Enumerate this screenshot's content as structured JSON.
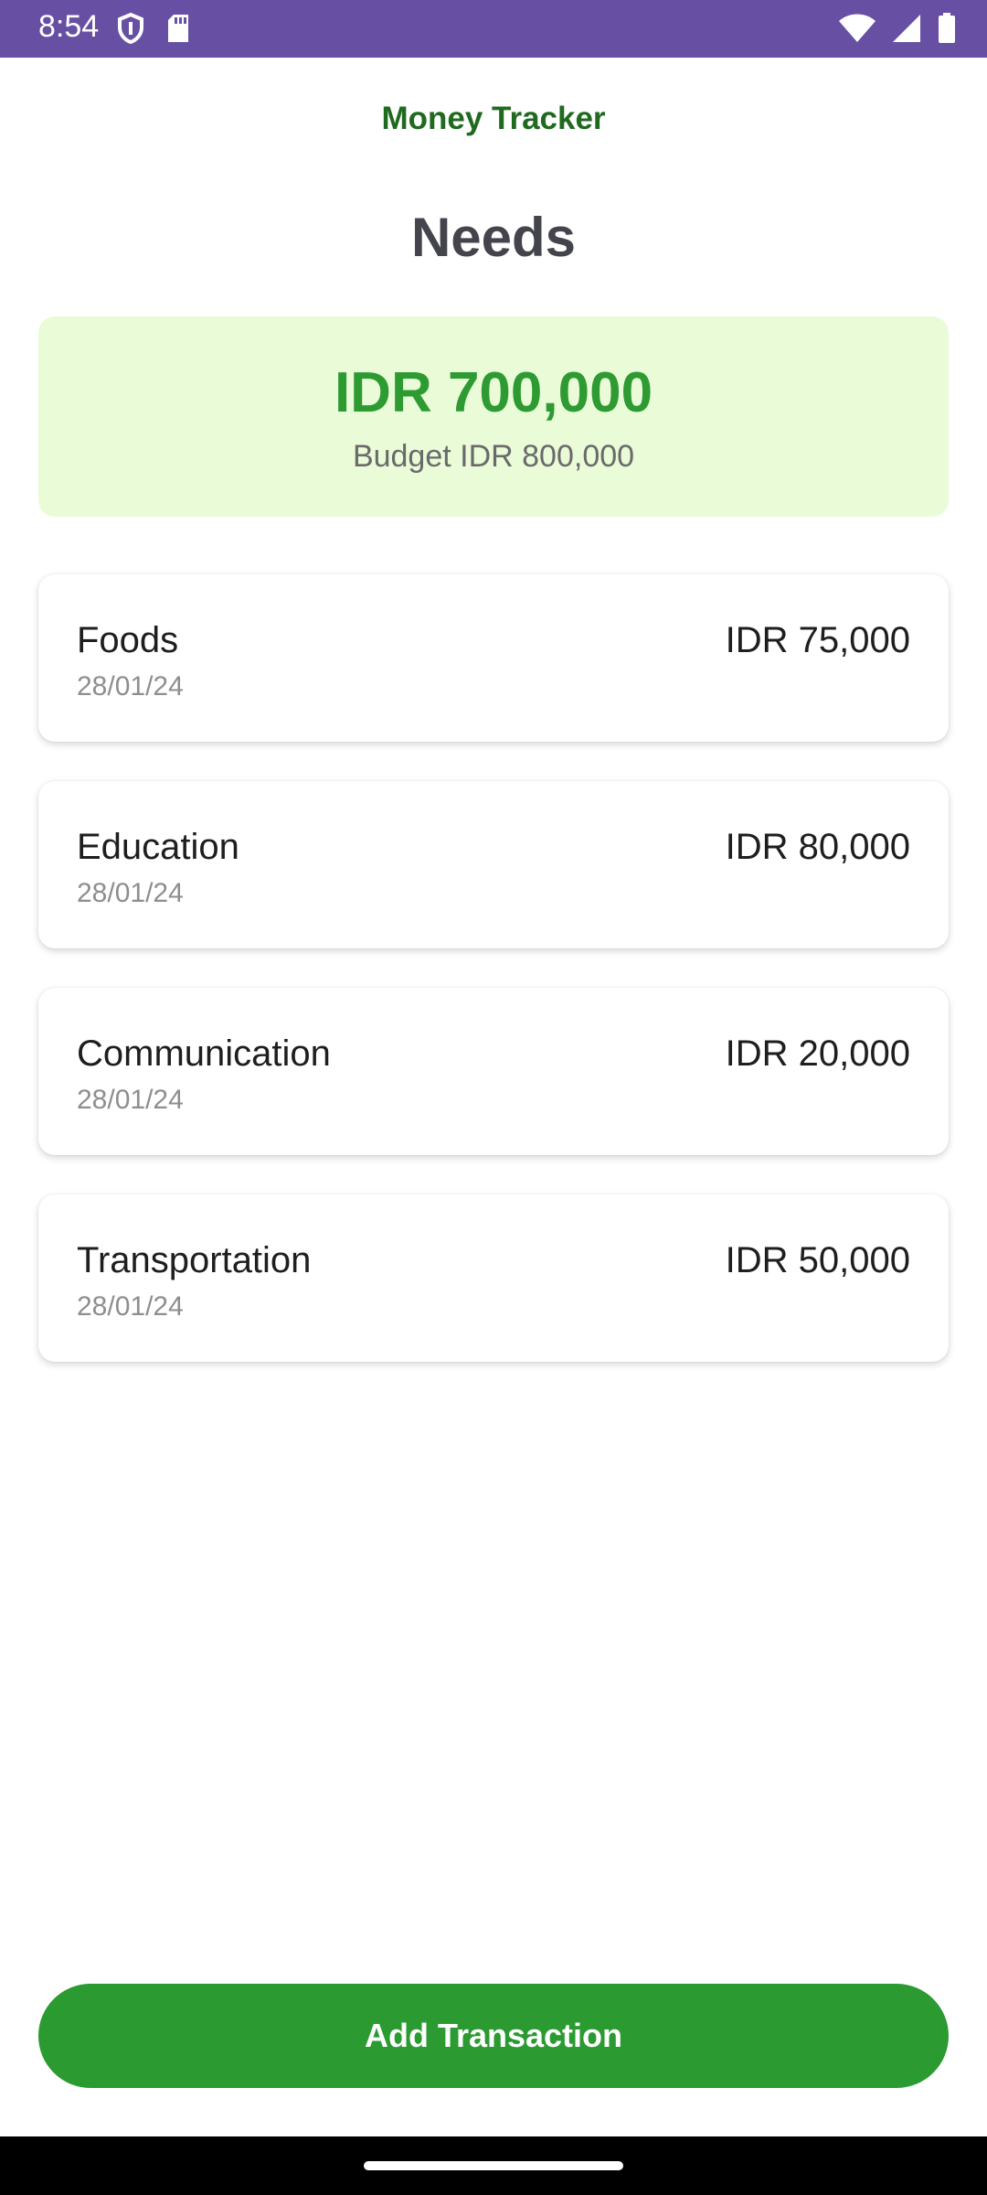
{
  "status_bar": {
    "time": "8:54",
    "left_icons": [
      "shield-icon",
      "sd-card-icon"
    ],
    "right_icons": [
      "wifi-icon",
      "cell-signal-icon",
      "battery-icon"
    ],
    "color": "#6750a4"
  },
  "app": {
    "title": "Money Tracker"
  },
  "page": {
    "title": "Needs"
  },
  "summary": {
    "amount": "IDR 700,000",
    "budget": "Budget IDR 800,000"
  },
  "transactions": [
    {
      "name": "Foods",
      "date": "28/01/24",
      "amount": "IDR 75,000"
    },
    {
      "name": "Education",
      "date": "28/01/24",
      "amount": "IDR 80,000"
    },
    {
      "name": "Communication",
      "date": "28/01/24",
      "amount": "IDR 20,000"
    },
    {
      "name": "Transportation",
      "date": "28/01/24",
      "amount": "IDR 50,000"
    }
  ],
  "actions": {
    "add_label": "Add Transaction"
  },
  "colors": {
    "accent": "#2a9a31",
    "summary_bg": "#eafbd8",
    "title_green": "#1f6a1f"
  }
}
